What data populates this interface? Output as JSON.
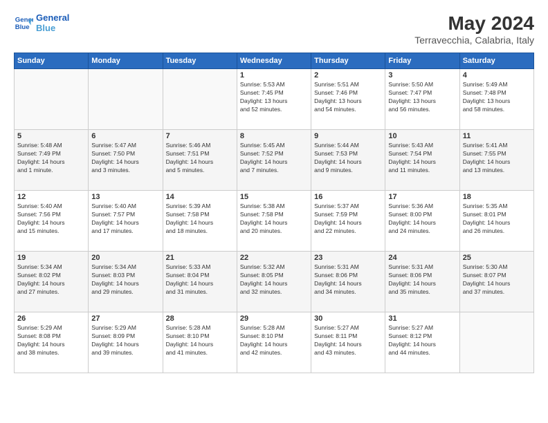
{
  "logo": {
    "line1": "General",
    "line2": "Blue"
  },
  "title": "May 2024",
  "subtitle": "Terravecchia, Calabria, Italy",
  "headers": [
    "Sunday",
    "Monday",
    "Tuesday",
    "Wednesday",
    "Thursday",
    "Friday",
    "Saturday"
  ],
  "weeks": [
    [
      {
        "num": "",
        "detail": ""
      },
      {
        "num": "",
        "detail": ""
      },
      {
        "num": "",
        "detail": ""
      },
      {
        "num": "1",
        "detail": "Sunrise: 5:53 AM\nSunset: 7:45 PM\nDaylight: 13 hours\nand 52 minutes."
      },
      {
        "num": "2",
        "detail": "Sunrise: 5:51 AM\nSunset: 7:46 PM\nDaylight: 13 hours\nand 54 minutes."
      },
      {
        "num": "3",
        "detail": "Sunrise: 5:50 AM\nSunset: 7:47 PM\nDaylight: 13 hours\nand 56 minutes."
      },
      {
        "num": "4",
        "detail": "Sunrise: 5:49 AM\nSunset: 7:48 PM\nDaylight: 13 hours\nand 58 minutes."
      }
    ],
    [
      {
        "num": "5",
        "detail": "Sunrise: 5:48 AM\nSunset: 7:49 PM\nDaylight: 14 hours\nand 1 minute."
      },
      {
        "num": "6",
        "detail": "Sunrise: 5:47 AM\nSunset: 7:50 PM\nDaylight: 14 hours\nand 3 minutes."
      },
      {
        "num": "7",
        "detail": "Sunrise: 5:46 AM\nSunset: 7:51 PM\nDaylight: 14 hours\nand 5 minutes."
      },
      {
        "num": "8",
        "detail": "Sunrise: 5:45 AM\nSunset: 7:52 PM\nDaylight: 14 hours\nand 7 minutes."
      },
      {
        "num": "9",
        "detail": "Sunrise: 5:44 AM\nSunset: 7:53 PM\nDaylight: 14 hours\nand 9 minutes."
      },
      {
        "num": "10",
        "detail": "Sunrise: 5:43 AM\nSunset: 7:54 PM\nDaylight: 14 hours\nand 11 minutes."
      },
      {
        "num": "11",
        "detail": "Sunrise: 5:41 AM\nSunset: 7:55 PM\nDaylight: 14 hours\nand 13 minutes."
      }
    ],
    [
      {
        "num": "12",
        "detail": "Sunrise: 5:40 AM\nSunset: 7:56 PM\nDaylight: 14 hours\nand 15 minutes."
      },
      {
        "num": "13",
        "detail": "Sunrise: 5:40 AM\nSunset: 7:57 PM\nDaylight: 14 hours\nand 17 minutes."
      },
      {
        "num": "14",
        "detail": "Sunrise: 5:39 AM\nSunset: 7:58 PM\nDaylight: 14 hours\nand 18 minutes."
      },
      {
        "num": "15",
        "detail": "Sunrise: 5:38 AM\nSunset: 7:58 PM\nDaylight: 14 hours\nand 20 minutes."
      },
      {
        "num": "16",
        "detail": "Sunrise: 5:37 AM\nSunset: 7:59 PM\nDaylight: 14 hours\nand 22 minutes."
      },
      {
        "num": "17",
        "detail": "Sunrise: 5:36 AM\nSunset: 8:00 PM\nDaylight: 14 hours\nand 24 minutes."
      },
      {
        "num": "18",
        "detail": "Sunrise: 5:35 AM\nSunset: 8:01 PM\nDaylight: 14 hours\nand 26 minutes."
      }
    ],
    [
      {
        "num": "19",
        "detail": "Sunrise: 5:34 AM\nSunset: 8:02 PM\nDaylight: 14 hours\nand 27 minutes."
      },
      {
        "num": "20",
        "detail": "Sunrise: 5:34 AM\nSunset: 8:03 PM\nDaylight: 14 hours\nand 29 minutes."
      },
      {
        "num": "21",
        "detail": "Sunrise: 5:33 AM\nSunset: 8:04 PM\nDaylight: 14 hours\nand 31 minutes."
      },
      {
        "num": "22",
        "detail": "Sunrise: 5:32 AM\nSunset: 8:05 PM\nDaylight: 14 hours\nand 32 minutes."
      },
      {
        "num": "23",
        "detail": "Sunrise: 5:31 AM\nSunset: 8:06 PM\nDaylight: 14 hours\nand 34 minutes."
      },
      {
        "num": "24",
        "detail": "Sunrise: 5:31 AM\nSunset: 8:06 PM\nDaylight: 14 hours\nand 35 minutes."
      },
      {
        "num": "25",
        "detail": "Sunrise: 5:30 AM\nSunset: 8:07 PM\nDaylight: 14 hours\nand 37 minutes."
      }
    ],
    [
      {
        "num": "26",
        "detail": "Sunrise: 5:29 AM\nSunset: 8:08 PM\nDaylight: 14 hours\nand 38 minutes."
      },
      {
        "num": "27",
        "detail": "Sunrise: 5:29 AM\nSunset: 8:09 PM\nDaylight: 14 hours\nand 39 minutes."
      },
      {
        "num": "28",
        "detail": "Sunrise: 5:28 AM\nSunset: 8:10 PM\nDaylight: 14 hours\nand 41 minutes."
      },
      {
        "num": "29",
        "detail": "Sunrise: 5:28 AM\nSunset: 8:10 PM\nDaylight: 14 hours\nand 42 minutes."
      },
      {
        "num": "30",
        "detail": "Sunrise: 5:27 AM\nSunset: 8:11 PM\nDaylight: 14 hours\nand 43 minutes."
      },
      {
        "num": "31",
        "detail": "Sunrise: 5:27 AM\nSunset: 8:12 PM\nDaylight: 14 hours\nand 44 minutes."
      },
      {
        "num": "",
        "detail": ""
      }
    ]
  ]
}
